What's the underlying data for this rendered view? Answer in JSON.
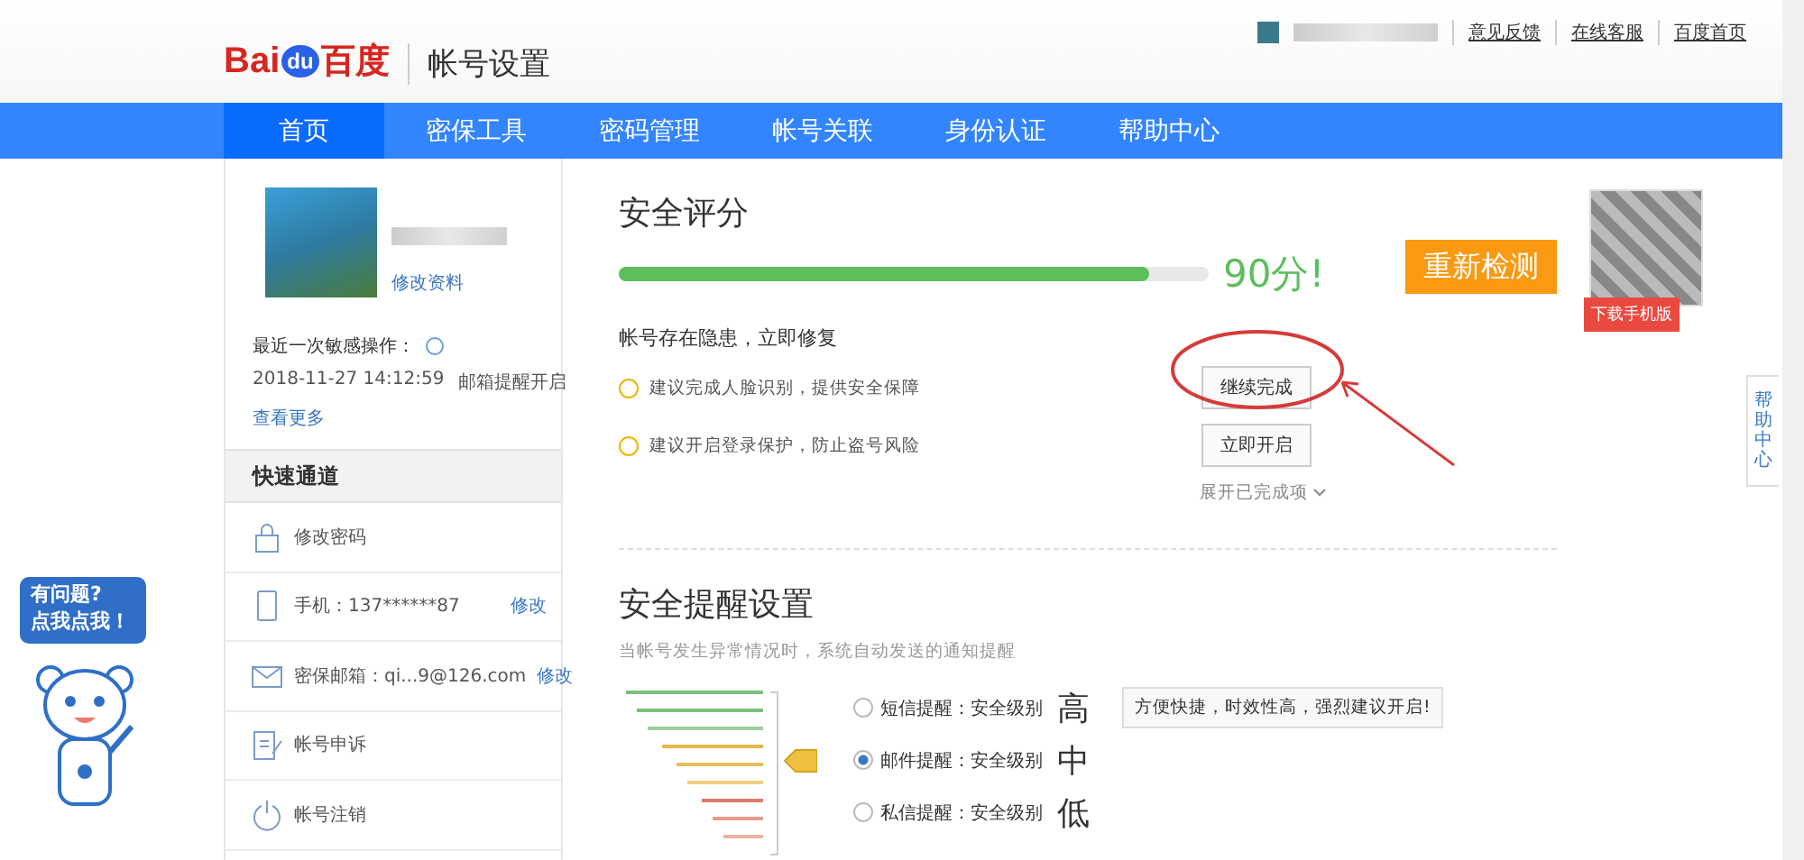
{
  "header": {
    "logo": {
      "part1": "Bai",
      "part2": "du",
      "part3": "百度"
    },
    "title": "帐号设置",
    "links": [
      "意见反馈",
      "在线客服",
      "百度首页"
    ]
  },
  "nav": [
    {
      "label": "首页",
      "selected": true
    },
    {
      "label": "密保工具",
      "selected": false
    },
    {
      "label": "密码管理",
      "selected": false
    },
    {
      "label": "帐号关联",
      "selected": false
    },
    {
      "label": "身份认证",
      "selected": false
    },
    {
      "label": "帮助中心",
      "selected": false
    }
  ],
  "profile": {
    "edit_link": "修改资料",
    "last_op_label": "最近一次敏感操作：",
    "last_op_time": "2018-11-27 14:12:59",
    "last_op_action": "邮箱提醒开启",
    "more_link": "查看更多"
  },
  "quick": {
    "title": "快速通道",
    "items": [
      {
        "kind": "lock",
        "label": "修改密码"
      },
      {
        "kind": "phone",
        "label": "手机：137******87",
        "action": "修改"
      },
      {
        "kind": "mail",
        "label": "密保邮箱：qi...9@126.com",
        "action": "修改"
      },
      {
        "kind": "appeal",
        "label": "帐号申诉"
      },
      {
        "kind": "power",
        "label": "帐号注销"
      }
    ]
  },
  "score": {
    "title": "安全评分",
    "level": 0.9,
    "value": "90分!",
    "recheck": "重新检测",
    "download": "下载手机版",
    "warning": "帐号存在隐患，立即修复",
    "tips": [
      {
        "text": "建议完成人脸识别，提供安全保障",
        "action": "继续完成",
        "circled": true
      },
      {
        "text": "建议开启登录保护，防止盗号风险",
        "action": "立即开启",
        "circled": false
      }
    ],
    "expand": "展开已完成项"
  },
  "reminder": {
    "title": "安全提醒设置",
    "subtitle": "当帐号发生异常情况时，系统自动发送的通知提醒",
    "options": [
      {
        "label": "短信提醒：安全级别",
        "grade": "高",
        "selected": false,
        "tip": "方便快捷，时效性高，强烈建议开启!"
      },
      {
        "label": "邮件提醒：安全级别",
        "grade": "中",
        "selected": true
      },
      {
        "label": "私信提醒：安全级别",
        "grade": "低",
        "selected": false
      }
    ]
  },
  "help_tab": "帮助中心",
  "mascot": {
    "line1": "有问题?",
    "line2": "点我点我！"
  }
}
